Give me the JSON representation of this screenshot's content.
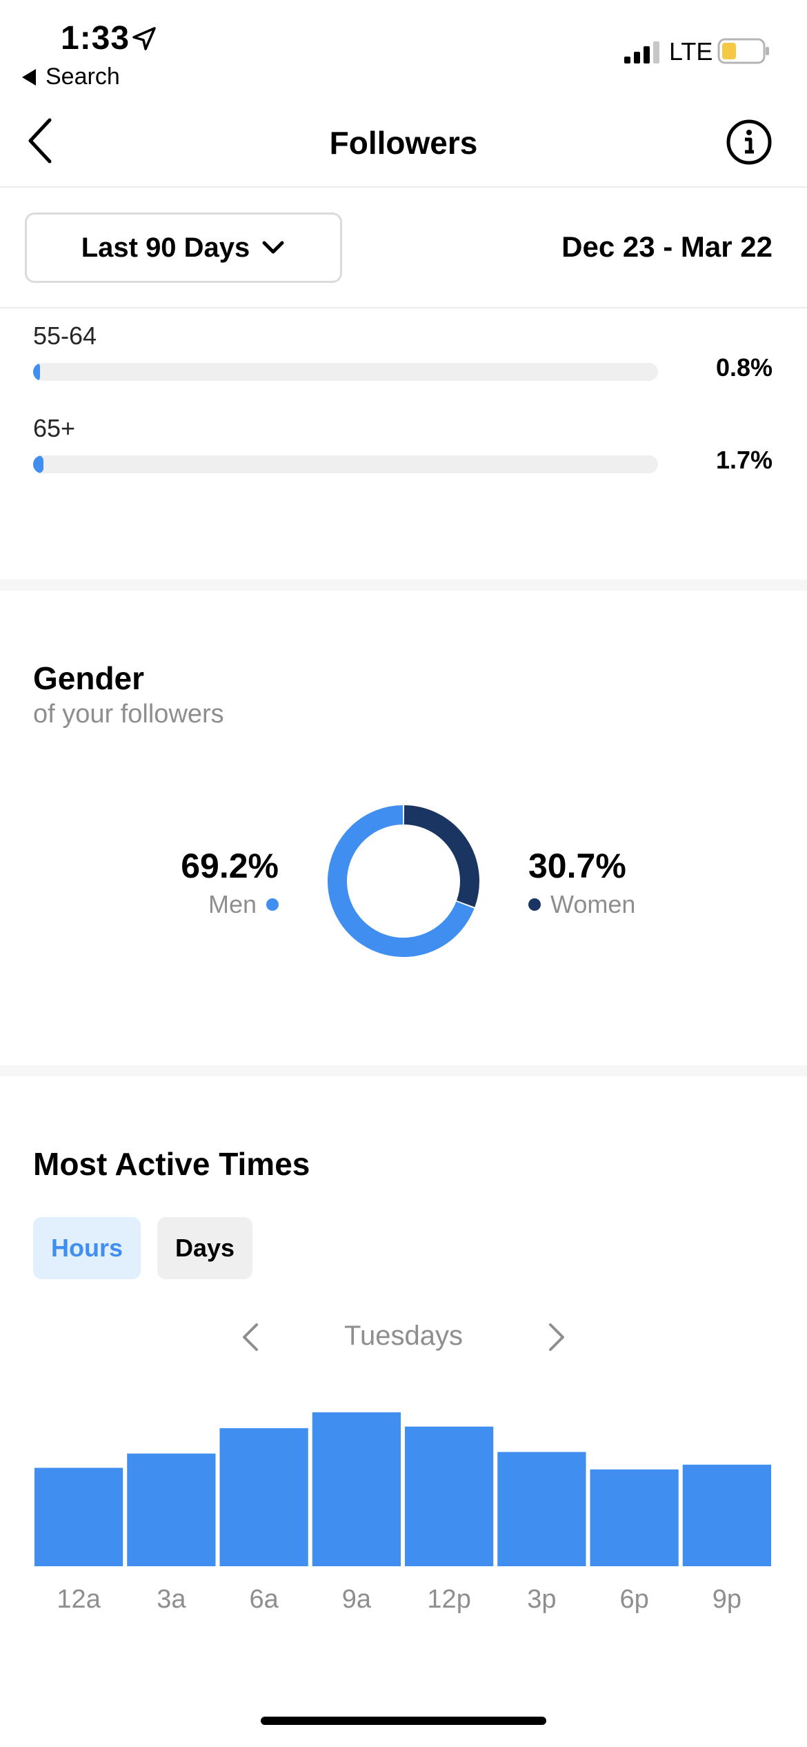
{
  "status_bar": {
    "time": "1:33",
    "back_app": "Search",
    "network": "LTE",
    "battery_color": "#f6c945"
  },
  "nav": {
    "title": "Followers"
  },
  "filter": {
    "period": "Last 90 Days",
    "date_range": "Dec 23 - Mar 22"
  },
  "age_ranges": [
    {
      "label": "55-64",
      "value": "0.8%",
      "fraction": 0.008
    },
    {
      "label": "65+",
      "value": "1.7%",
      "fraction": 0.017
    }
  ],
  "gender": {
    "title": "Gender",
    "subtitle": "of your followers",
    "men": {
      "value": "69.2%",
      "label": "Men",
      "fraction": 0.692,
      "color": "#3f8ef0"
    },
    "women": {
      "value": "30.7%",
      "label": "Women",
      "fraction": 0.307,
      "color": "#1b3562"
    }
  },
  "active_times": {
    "title": "Most Active Times",
    "tabs": {
      "hours": "Hours",
      "days": "Days"
    },
    "day_label": "Tuesdays"
  },
  "chart_data": {
    "type": "bar",
    "categories": [
      "12a",
      "3a",
      "6a",
      "9a",
      "12p",
      "3p",
      "6p",
      "9p"
    ],
    "values": [
      62,
      71,
      87,
      97,
      88,
      72,
      61,
      64
    ],
    "ylim": [
      0,
      100
    ],
    "color": "#3f8ef0",
    "grid": false
  }
}
